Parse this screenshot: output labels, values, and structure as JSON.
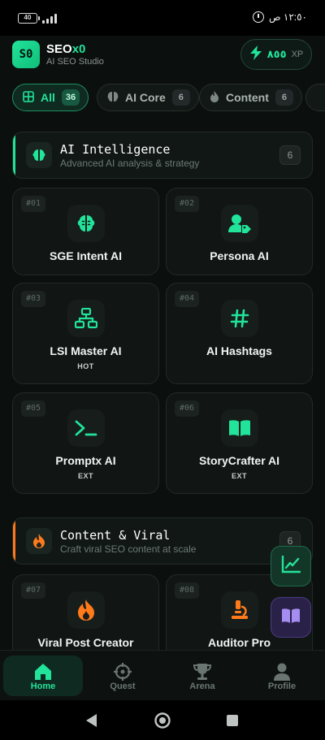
{
  "status_bar": {
    "battery": "40",
    "time": "١٢:٥٠ ص"
  },
  "header": {
    "logo": "S0",
    "title_main": "SEO",
    "title_accent": "x0",
    "subtitle": "AI SEO Studio",
    "xp_value": "٨٥٥",
    "xp_unit": "XP"
  },
  "tabs": [
    {
      "label": "All",
      "count": "36",
      "icon": "grid-icon",
      "active": true
    },
    {
      "label": "AI Core",
      "count": "6",
      "icon": "brain-icon",
      "active": false
    },
    {
      "label": "Content",
      "count": "6",
      "icon": "flame-icon",
      "active": false
    }
  ],
  "sections": [
    {
      "title": "AI Intelligence",
      "subtitle": "Advanced AI analysis & strategy",
      "count": "6",
      "accent": "#22e39a",
      "icon": "brain-icon"
    },
    {
      "title": "Content & Viral",
      "subtitle": "Craft viral SEO content at scale",
      "count": "6",
      "accent": "#ff7a1a",
      "icon": "flame-icon"
    }
  ],
  "cards": [
    {
      "num": "#01",
      "name": "SGE Intent AI",
      "tag": "",
      "icon": "brain-icon"
    },
    {
      "num": "#02",
      "name": "Persona AI",
      "tag": "",
      "icon": "user-tag-icon"
    },
    {
      "num": "#03",
      "name": "LSI Master AI",
      "tag": "HOT",
      "icon": "network-icon"
    },
    {
      "num": "#04",
      "name": "AI Hashtags",
      "tag": "",
      "icon": "hashtag-icon"
    },
    {
      "num": "#05",
      "name": "Promptx AI",
      "tag": "EXT",
      "icon": "terminal-icon"
    },
    {
      "num": "#06",
      "name": "StoryCrafter AI",
      "tag": "EXT",
      "icon": "book-icon"
    },
    {
      "num": "#07",
      "name": "Viral Post Creator",
      "tag": "",
      "icon": "fire-icon"
    },
    {
      "num": "#08",
      "name": "Auditor Pro",
      "tag": "",
      "icon": "microscope-icon"
    }
  ],
  "bottom_nav": [
    {
      "label": "Home",
      "icon": "home-icon",
      "active": true
    },
    {
      "label": "Quest",
      "icon": "crosshair-icon",
      "active": false
    },
    {
      "label": "Arena",
      "icon": "trophy-icon",
      "active": false
    },
    {
      "label": "Profile",
      "icon": "user-icon",
      "active": false
    }
  ],
  "colors": {
    "accent": "#22e39a",
    "orange": "#ff7a1a",
    "background": "#0b0f0e"
  }
}
